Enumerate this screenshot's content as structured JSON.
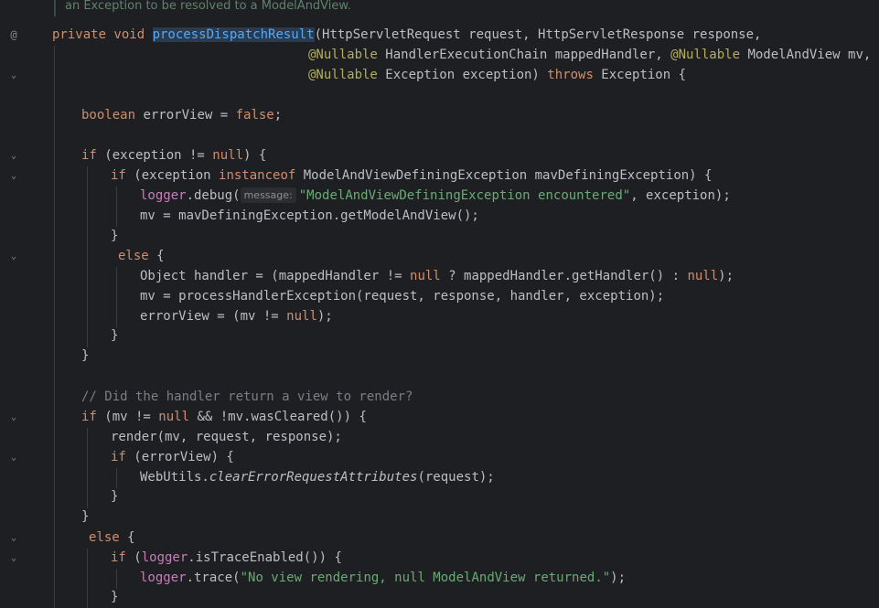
{
  "editor": {
    "doc_comment": "an Exception to be resolved to a ModelAndView.",
    "lines": {
      "sig1_a": "private void ",
      "sig1_fn": "processDispatchResult",
      "sig1_b": "(HttpServletRequest request, HttpServletResponse response,",
      "sig2_ann": "@Nullable",
      "sig2_b": " HandlerExecutionChain mappedHandler, ",
      "sig2_ann2": "@Nullable",
      "sig2_c": " ModelAndView mv,",
      "sig3_ann": "@Nullable",
      "sig3_b": " Exception exception) ",
      "sig3_kw": "throws",
      "sig3_c": " Exception {",
      "l4_kw": "boolean",
      "l4_b": " errorView = ",
      "l4_kw2": "false",
      "l4_c": ";",
      "l5_kw": "if",
      "l5_b": " (exception != ",
      "l5_kw2": "null",
      "l5_c": ") {",
      "l6_kw": "if",
      "l6_b": " (exception ",
      "l6_kw2": "instanceof",
      "l6_c": " ModelAndViewDefiningException mavDefiningException) {",
      "l7_fld": "logger",
      "l7_b": ".debug(",
      "l7_hint": "message:",
      "l7_str": "\"ModelAndViewDefiningException encountered\"",
      "l7_c": ", exception);",
      "l8": "mv = mavDefiningException.getModelAndView();",
      "l9": "}",
      "l10_kw": "else",
      "l10_b": " {",
      "l11_a": "Object handler = (mappedHandler != ",
      "l11_kw": "null",
      "l11_b": " ? mappedHandler.getHandler() : ",
      "l11_kw2": "null",
      "l11_c": ");",
      "l12": "mv = processHandlerException(request, response, handler, exception);",
      "l13_a": "errorView = (mv != ",
      "l13_kw": "null",
      "l13_b": ");",
      "l14": "}",
      "l15": "}",
      "l16_cmt": "// Did the handler return a view to render?",
      "l17_kw": "if",
      "l17_b": " (mv != ",
      "l17_kw2": "null",
      "l17_c": " && !mv.wasCleared()) {",
      "l18": "render(mv, request, response);",
      "l19_kw": "if",
      "l19_b": " (errorView) {",
      "l20_a": "WebUtils.",
      "l20_it": "clearErrorRequestAttributes",
      "l20_b": "(request);",
      "l21": "}",
      "l22": "}",
      "l23_kw": "else",
      "l23_b": " {",
      "l24_kw": "if",
      "l24_b": " (",
      "l24_fld": "logger",
      "l24_c": ".isTraceEnabled()) {",
      "l25_fld": "logger",
      "l25_b": ".trace(",
      "l25_str": "\"No view rendering, null ModelAndView returned.\"",
      "l25_c": ");",
      "l26": "}"
    }
  },
  "gutter": {
    "override_icon": "@",
    "fold_icon": "⌄"
  }
}
